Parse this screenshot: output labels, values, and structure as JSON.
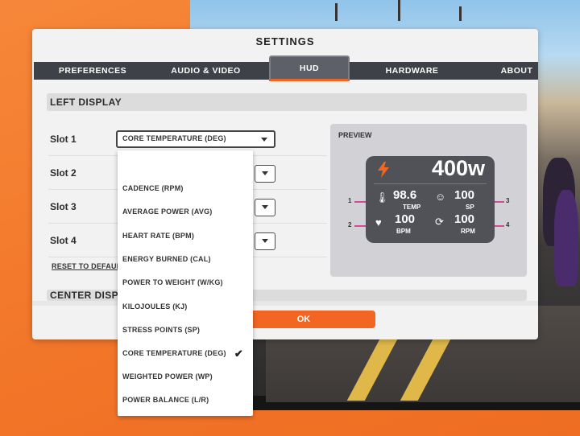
{
  "window": {
    "title": "SETTINGS"
  },
  "tabs": [
    {
      "label": "PREFERENCES",
      "active": false
    },
    {
      "label": "AUDIO & VIDEO",
      "active": false
    },
    {
      "label": "HUD",
      "active": true
    },
    {
      "label": "HARDWARE",
      "active": false
    },
    {
      "label": "ABOUT",
      "active": false
    }
  ],
  "left_display": {
    "title": "LEFT DISPLAY",
    "slots": [
      {
        "label": "Slot 1",
        "value": "CORE TEMPERATURE (DEG)"
      },
      {
        "label": "Slot 2",
        "value": ""
      },
      {
        "label": "Slot 3",
        "value": ""
      },
      {
        "label": "Slot 4",
        "value": ""
      }
    ],
    "reset_label": "RESET TO DEFAULTS"
  },
  "center_display": {
    "title": "CENTER DISPLAY"
  },
  "preview": {
    "label": "PREVIEW",
    "power": {
      "value": "400w",
      "icon": "lightning-icon"
    },
    "cells": [
      {
        "pin": "1",
        "value": "98.6",
        "unit": "TEMP",
        "icon": "thermometer-icon"
      },
      {
        "pin": "3",
        "value": "100",
        "unit": "SP",
        "icon": "stress-face-icon"
      },
      {
        "pin": "2",
        "value": "100",
        "unit": "BPM",
        "icon": "heart-rate-icon"
      },
      {
        "pin": "4",
        "value": "100",
        "unit": "RPM",
        "icon": "cadence-icon"
      }
    ]
  },
  "ok_label": "OK",
  "dropdown_menu": {
    "options": [
      {
        "label": "CADENCE (RPM)",
        "selected": false
      },
      {
        "label": "AVERAGE POWER (AVG)",
        "selected": false
      },
      {
        "label": "HEART RATE (BPM)",
        "selected": false
      },
      {
        "label": "ENERGY BURNED (CAL)",
        "selected": false
      },
      {
        "label": "POWER TO WEIGHT (W/KG)",
        "selected": false
      },
      {
        "label": "KILOJOULES (KJ)",
        "selected": false
      },
      {
        "label": "STRESS POINTS (SP)",
        "selected": false
      },
      {
        "label": "CORE TEMPERATURE (DEG)",
        "selected": true
      },
      {
        "label": "WEIGHTED POWER (WP)",
        "selected": false
      },
      {
        "label": "POWER BALANCE (L/R)",
        "selected": false
      }
    ]
  },
  "colors": {
    "accent": "#f26522",
    "tabbar": "#3f4148",
    "hud_bg": "#505258",
    "pin_line": "#d24a9b"
  }
}
